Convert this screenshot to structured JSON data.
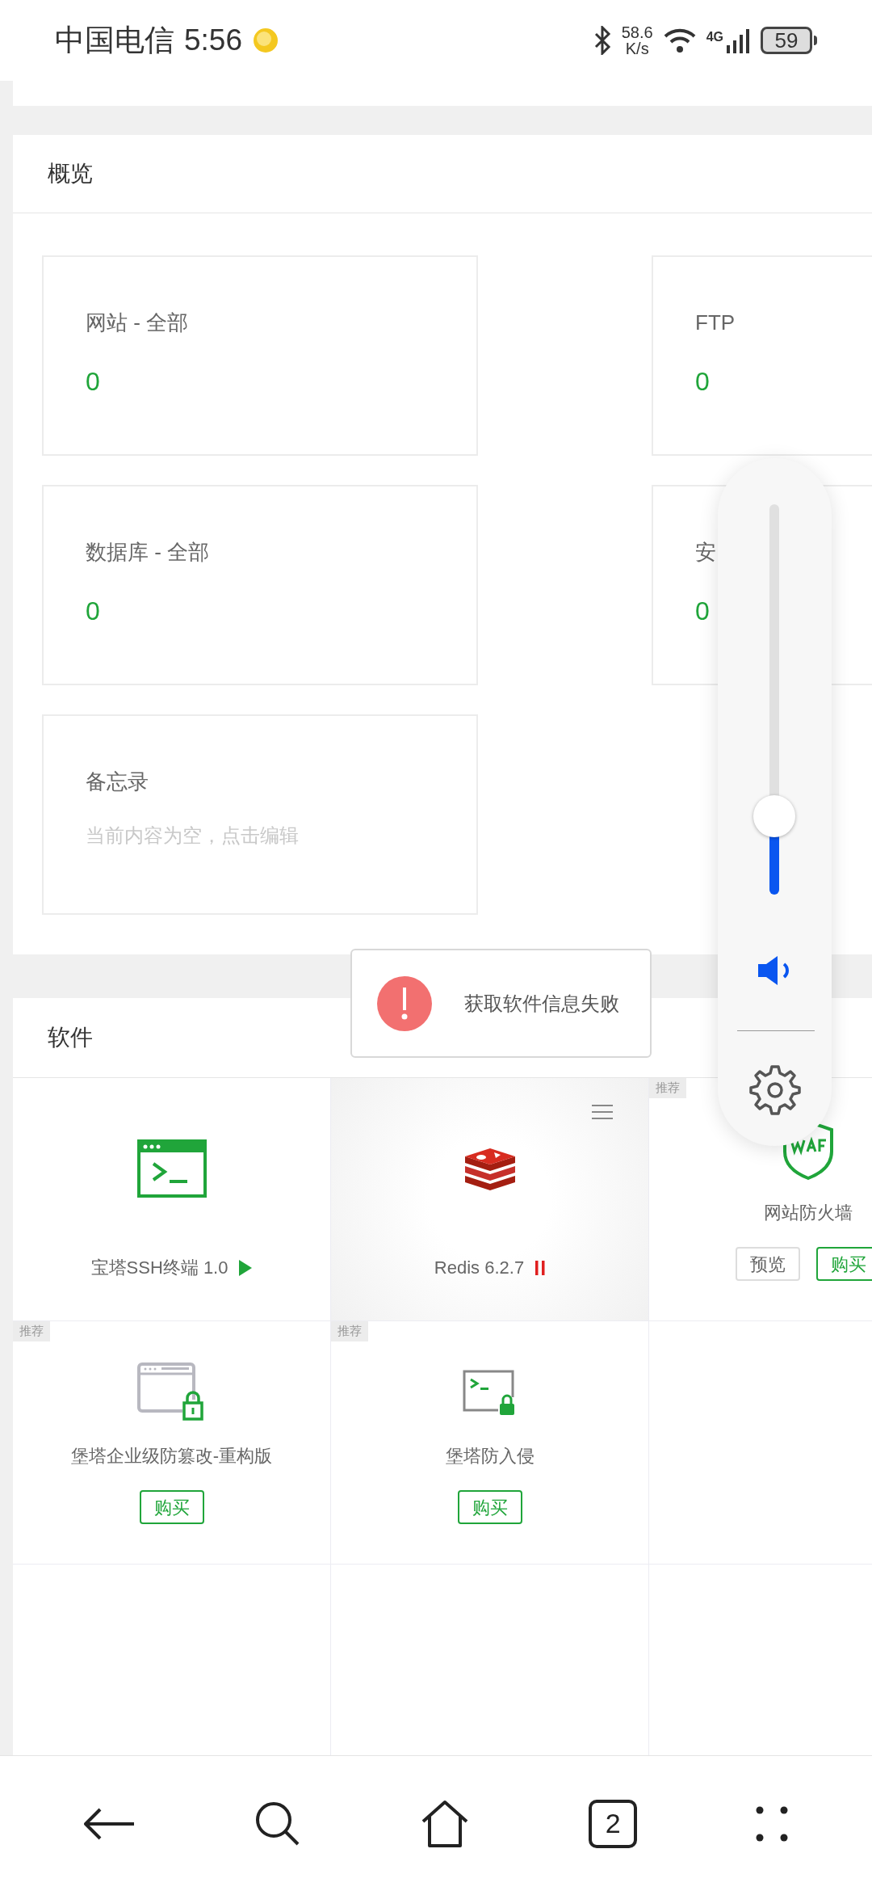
{
  "status_bar": {
    "carrier": "中国电信",
    "time": "5:56",
    "net_speed": "58.6",
    "net_speed_unit": "K/s",
    "network": "4G",
    "battery": "59"
  },
  "overview": {
    "title": "概览",
    "stats": [
      {
        "label": "网站 - 全部",
        "value": "0"
      },
      {
        "label": "FTP",
        "value": "0"
      },
      {
        "label": "数据库 - 全部",
        "value": "0"
      },
      {
        "label": "安",
        "value": "0"
      }
    ],
    "memo": {
      "title": "备忘录",
      "hint": "当前内容为空，点击编辑"
    }
  },
  "software": {
    "title": "软件",
    "items": [
      {
        "kind": "installed",
        "name": "宝塔SSH终端 1.0",
        "running": true,
        "highlighted": false
      },
      {
        "kind": "installed",
        "name": "Redis 6.2.7",
        "running": false,
        "highlighted": true
      },
      {
        "kind": "store",
        "badge": "推荐",
        "name": "网站防火墙",
        "buttons": [
          "预览",
          "购买"
        ]
      },
      {
        "kind": "store",
        "badge": "推荐",
        "name": "堡塔企业级防篡改-重构版",
        "buttons": [
          "购买"
        ]
      },
      {
        "kind": "store",
        "badge": "推荐",
        "name": "堡塔防入侵",
        "buttons": [
          "购买"
        ]
      }
    ]
  },
  "toast": {
    "message": "获取软件信息失败"
  },
  "volume": {
    "level": 0.2
  },
  "nav_bar": {
    "tabs_count": "2"
  }
}
